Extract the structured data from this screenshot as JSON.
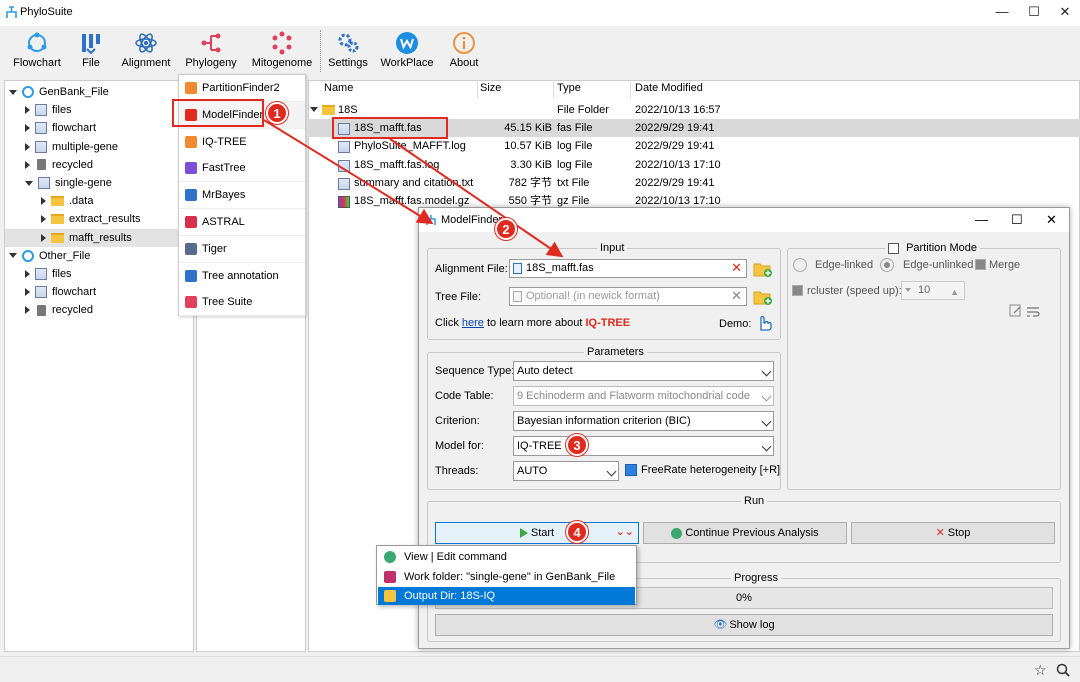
{
  "app": {
    "title": "PhyloSuite",
    "win_min": "—",
    "win_max": "☐",
    "win_close": "✕"
  },
  "toolbar": [
    {
      "label": "Flowchart",
      "icon": "flowchart-icon",
      "color": "#2d9ce6"
    },
    {
      "label": "File",
      "icon": "file-icon",
      "color": "#2d72c6"
    },
    {
      "label": "Alignment",
      "icon": "alignment-icon",
      "color": "#2a6ab8"
    },
    {
      "label": "Phylogeny",
      "icon": "phylogeny-icon",
      "color": "#e0405a"
    },
    {
      "label": "Mitogenome",
      "icon": "mitogenome-icon",
      "color": "#e0405a"
    },
    {
      "label": "Settings",
      "icon": "settings-icon",
      "color": "#2d72c6"
    },
    {
      "label": "WorkPlace",
      "icon": "workplace-icon",
      "color": "#1d8fe0"
    },
    {
      "label": "About",
      "icon": "about-icon",
      "color": "#f08a30"
    }
  ],
  "tree": [
    {
      "label": "GenBank_File",
      "level": 0,
      "type": "root",
      "expanded": true
    },
    {
      "label": "files",
      "level": 1,
      "type": "file"
    },
    {
      "label": "flowchart",
      "level": 1,
      "type": "file"
    },
    {
      "label": "multiple-gene",
      "level": 1,
      "type": "file"
    },
    {
      "label": "recycled",
      "level": 1,
      "type": "trash"
    },
    {
      "label": "single-gene",
      "level": 1,
      "type": "file",
      "expanded": true
    },
    {
      "label": ".data",
      "level": 2,
      "type": "folder"
    },
    {
      "label": "extract_results",
      "level": 2,
      "type": "folder"
    },
    {
      "label": "mafft_results",
      "level": 2,
      "type": "folder",
      "selected": true
    },
    {
      "label": "Other_File",
      "level": 0,
      "type": "root",
      "expanded": true
    },
    {
      "label": "files",
      "level": 1,
      "type": "file"
    },
    {
      "label": "flowchart",
      "level": 1,
      "type": "file"
    },
    {
      "label": "recycled",
      "level": 1,
      "type": "trash"
    }
  ],
  "phylo_menu": [
    {
      "label": "PartitionFinder2",
      "color": "#f08a30"
    },
    {
      "label": "ModelFinder",
      "color": "#e0291f",
      "highlight": true
    },
    {
      "label": "IQ-TREE",
      "color": "#f08a30"
    },
    {
      "label": "FastTree",
      "color": "#7b4fd8"
    },
    {
      "label": "MrBayes",
      "color": "#2d72c6"
    },
    {
      "label": "ASTRAL",
      "color": "#d8304a"
    },
    {
      "label": "Tiger",
      "color": "#5a6a8a"
    },
    {
      "label": "Tree annotation",
      "color": "#2d72c6"
    },
    {
      "label": "Tree Suite",
      "color": "#e0405a"
    }
  ],
  "files": {
    "headers": {
      "name": "Name",
      "size": "Size",
      "type": "Type",
      "date": "Date Modified"
    },
    "rows": [
      {
        "name": "18S",
        "size": "",
        "type": "File Folder",
        "date": "2022/10/13 16:57",
        "kind": "folder"
      },
      {
        "name": "18S_mafft.fas",
        "size": "45.15 KiB",
        "type": "fas File",
        "date": "2022/9/29 19:41",
        "kind": "file",
        "selected": true
      },
      {
        "name": "PhyloSuite_MAFFT.log",
        "size": "10.57 KiB",
        "type": "log File",
        "date": "2022/9/29 19:41",
        "kind": "file"
      },
      {
        "name": "18S_mafft.fas.log",
        "size": "3.30 KiB",
        "type": "log File",
        "date": "2022/10/13 17:10",
        "kind": "file"
      },
      {
        "name": "summary and citation.txt",
        "size": "782 字节",
        "type": "txt File",
        "date": "2022/9/29 19:41",
        "kind": "file"
      },
      {
        "name": "18S_mafft.fas.model.gz",
        "size": "550 字节",
        "type": "gz File",
        "date": "2022/10/13 17:10",
        "kind": "gz"
      }
    ]
  },
  "dialog": {
    "title": "ModelFinder",
    "input": {
      "title": "Input",
      "alignment_label": "Alignment File:",
      "alignment_value": "18S_mafft.fas",
      "tree_label": "Tree File:",
      "tree_placeholder": "Optional! (in newick format)",
      "click_text": "Click",
      "here_link": "here",
      "learn_text": "to learn more about",
      "iqtree_text": "IQ-TREE",
      "demo_label": "Demo:"
    },
    "partition": {
      "title": "Partition Mode",
      "edge_linked": "Edge-linked",
      "edge_unlinked": "Edge-unlinked",
      "merge": "Merge",
      "rcluster_label": "rcluster (speed up):",
      "rcluster_value": "10"
    },
    "parameters": {
      "title": "Parameters",
      "seq_type_label": "Sequence Type:",
      "seq_type_value": "Auto detect",
      "code_table_label": "Code Table:",
      "code_table_value": "9 Echinoderm and Flatworm mitochondrial code",
      "criterion_label": "Criterion:",
      "criterion_value": "Bayesian information criterion (BIC)",
      "model_for_label": "Model for:",
      "model_for_value": "IQ-TREE",
      "threads_label": "Threads:",
      "threads_value": "AUTO",
      "freerate_label": "FreeRate heterogeneity [+R]"
    },
    "run": {
      "title": "Run",
      "start": "Start",
      "continue": "Continue Previous Analysis",
      "stop": "Stop"
    },
    "progress": {
      "title": "Progress",
      "value": "0%",
      "percent": 0
    },
    "show_log": "Show log"
  },
  "context_menu": [
    {
      "label": "View | Edit command",
      "icon": "command-icon",
      "color": "#3aa870"
    },
    {
      "label": "Work folder: \"single-gene\" in GenBank_File",
      "icon": "briefcase-icon",
      "color": "#c0306a"
    },
    {
      "label": "Output Dir: 18S-IQ",
      "icon": "folder-icon",
      "color": "#f5c542",
      "selected": true
    }
  ],
  "badges": [
    "1",
    "2",
    "3",
    "4"
  ]
}
